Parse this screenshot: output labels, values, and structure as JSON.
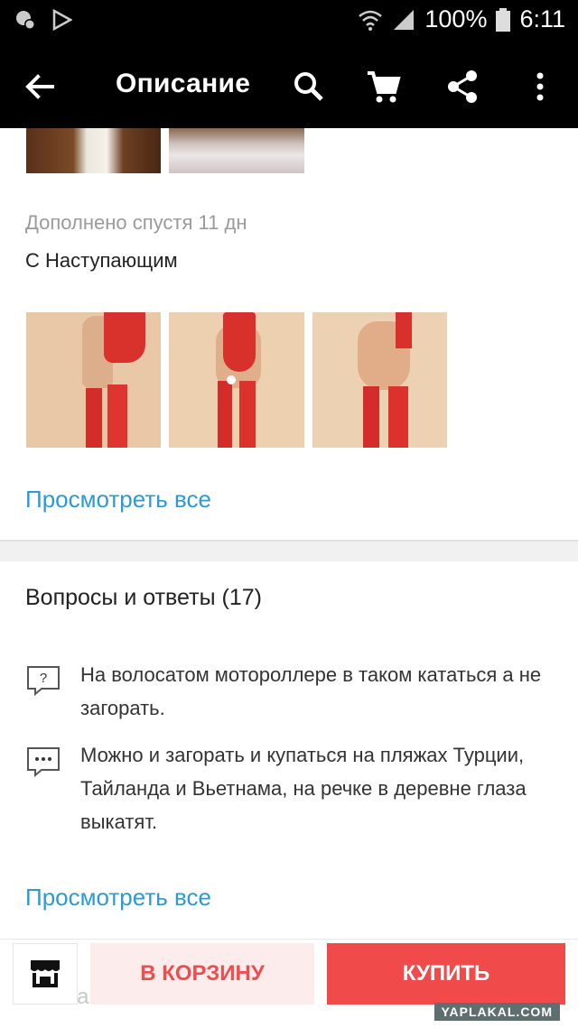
{
  "status_bar": {
    "battery": "100%",
    "time": "6:11"
  },
  "app_bar": {
    "title": "Описание"
  },
  "review": {
    "added_note": "Дополнено спустя 11 дн",
    "comment": "С Наступающим",
    "view_all": "Просмотреть все"
  },
  "qa": {
    "title": "Вопросы и ответы (17)",
    "question": "На волосатом мотороллере в таком кататься а не загорать.",
    "answer": "Можно и загорать и купаться на пляжах Турции, Тайланда и Вьетнама, на речке в деревне глаза выкатят.",
    "view_all": "Просмотреть все"
  },
  "bottom_bar": {
    "cart_label": "В КОРЗИНУ",
    "buy_label": "КУПИТЬ",
    "ghost_text": "Описа"
  },
  "watermark": "YAPLAKAL.COM",
  "colors": {
    "accent": "#f04a4a",
    "link": "#2e9ad0",
    "cart_bg": "#fdecec"
  }
}
